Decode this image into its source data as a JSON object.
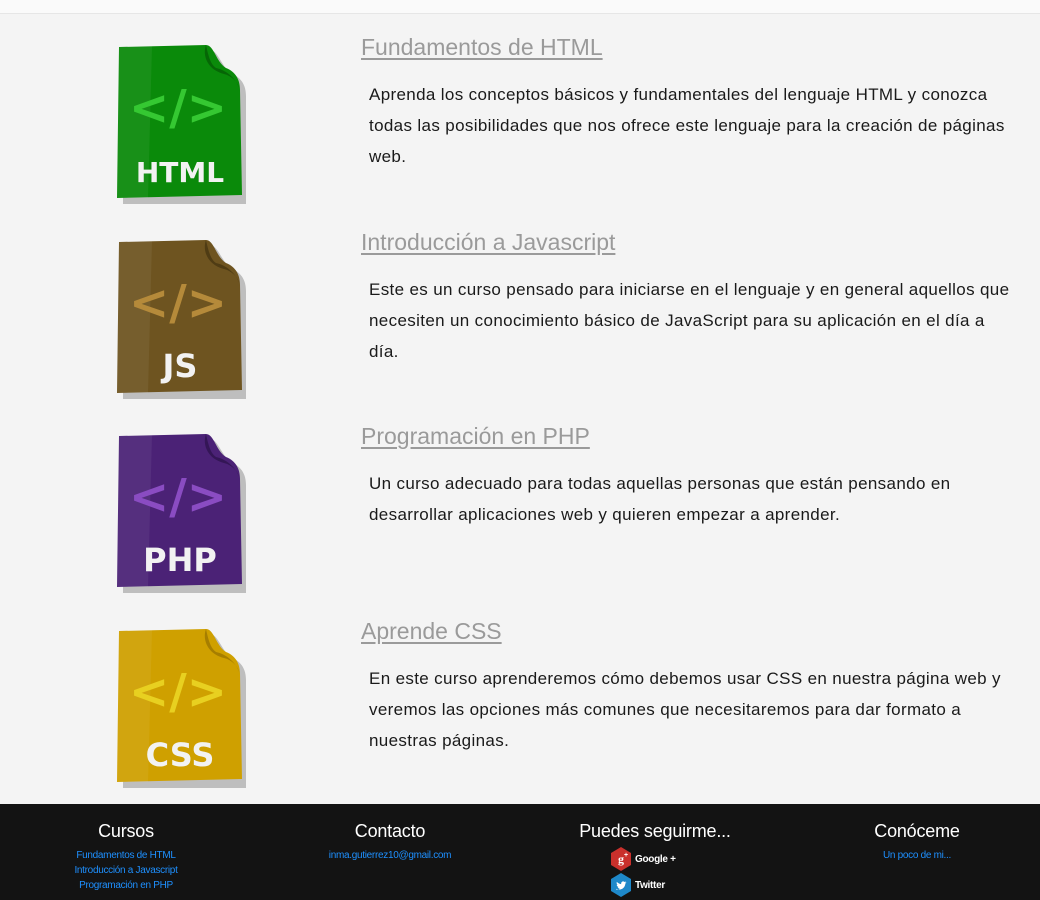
{
  "courses": [
    {
      "title": "Fundamentos de HTML",
      "description": "Aprenda los conceptos básicos y fundamentales del lenguaje HTML y conozca todas las posibilidades que nos ofrece este lenguaje para la creación de páginas web.",
      "icon": {
        "name": "html-file-icon",
        "label": "HTML",
        "glyph": "</>",
        "color": "#0a8a0a",
        "dark": "#066606",
        "glyph_color": "#35c832"
      }
    },
    {
      "title": "Introducción a Javascript",
      "description": "Este es un curso pensado para iniciarse en el lenguaje y en general aquellos que necesiten un conocimiento básico de JavaScript para su aplicación en el día a día.",
      "icon": {
        "name": "js-file-icon",
        "label": "JS",
        "glyph": "</>",
        "color": "#6e5420",
        "dark": "#4f3c14",
        "glyph_color": "#b58a3a"
      }
    },
    {
      "title": "Programación en PHP",
      "description": "Un curso adecuado para todas aquellas personas que están pensando en desarrollar aplicaciones web y quieren empezar a aprender.",
      "icon": {
        "name": "php-file-icon",
        "label": "PHP",
        "glyph": "</>",
        "color": "#4b2276",
        "dark": "#341656",
        "glyph_color": "#8a4cc2"
      }
    },
    {
      "title": "Aprende CSS",
      "description": "En este curso aprenderemos cómo debemos usar CSS en nuestra página web y veremos las opciones más comunes que necesitaremos para dar formato a nuestras páginas.",
      "icon": {
        "name": "css-file-icon",
        "label": "CSS",
        "glyph": "</>",
        "color": "#cfa000",
        "dark": "#a67e00",
        "glyph_color": "#e8d020"
      }
    }
  ],
  "footer": {
    "cursos": {
      "heading": "Cursos",
      "links": [
        "Fundamentos de HTML",
        "Introducción a Javascript",
        "Programación en PHP"
      ]
    },
    "contacto": {
      "heading": "Contacto",
      "email": "inma.gutierrez10@gmail.com"
    },
    "social": {
      "heading": "Puedes seguirme...",
      "items": [
        {
          "label": "Google +",
          "icon": "google-plus-icon",
          "color": "#c9302c"
        },
        {
          "label": "Twitter",
          "icon": "twitter-icon",
          "color": "#1da1f2"
        }
      ]
    },
    "conoceme": {
      "heading": "Conóceme",
      "link": "Un poco de mi..."
    }
  }
}
